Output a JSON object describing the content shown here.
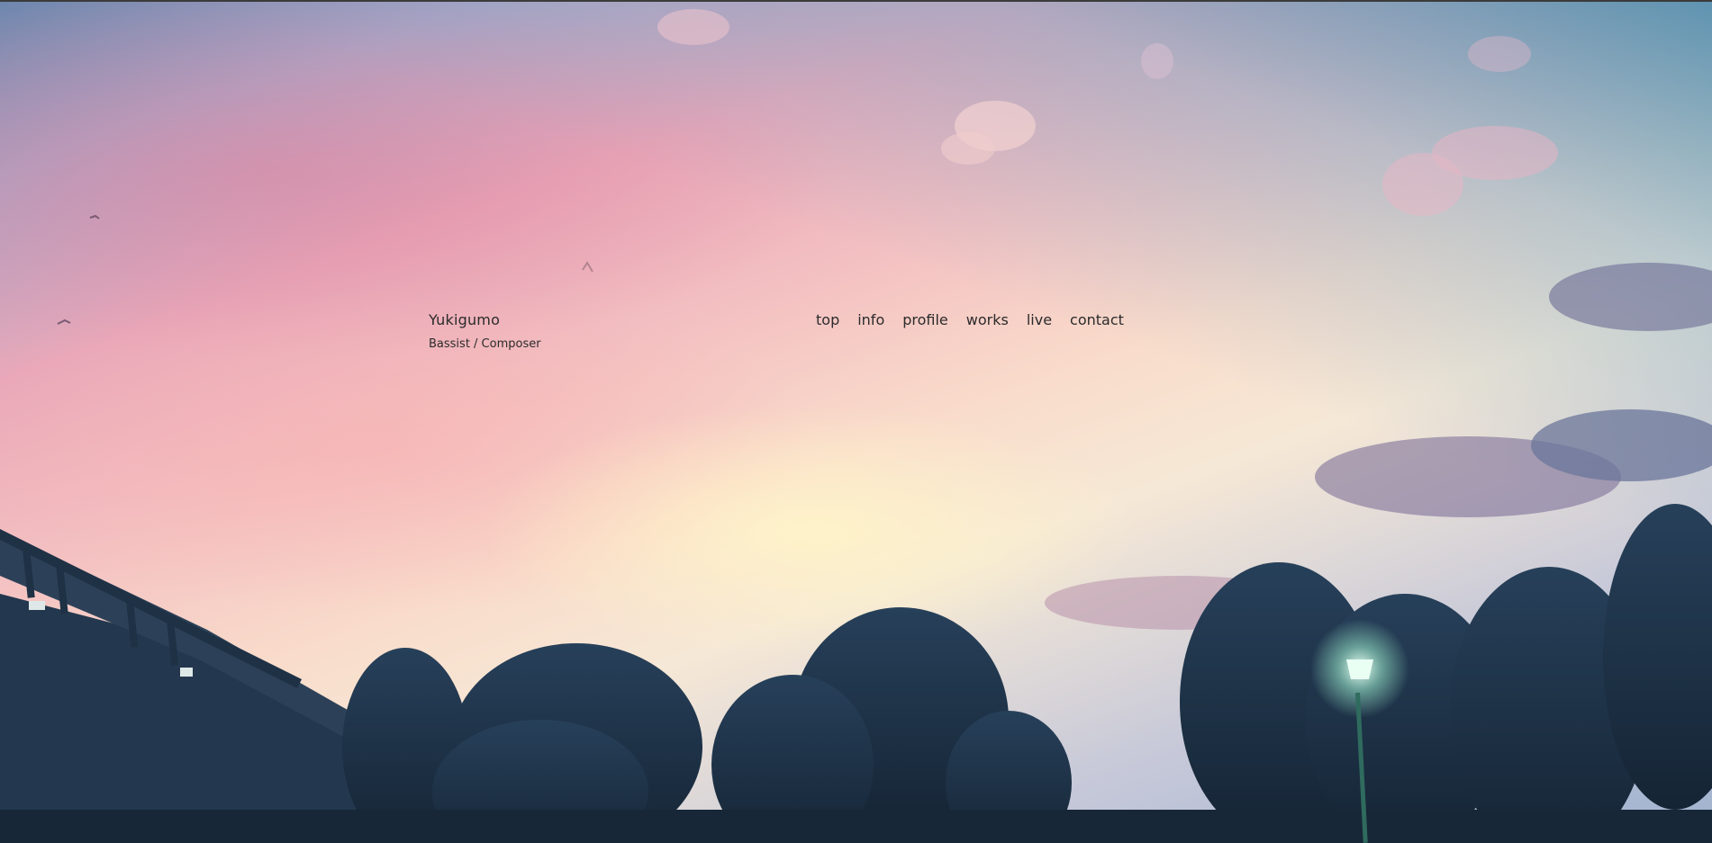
{
  "site": {
    "title": "Yukigumo",
    "subtitle": "Bassist / Composer"
  },
  "nav": {
    "items": [
      {
        "label": "top"
      },
      {
        "label": "info"
      },
      {
        "label": "profile"
      },
      {
        "label": "works"
      },
      {
        "label": "live"
      },
      {
        "label": "contact"
      }
    ]
  },
  "colors": {
    "text": "#2b2b2b",
    "sky_top_right": "#2c82aa",
    "sky_pink": "#e9a8b9",
    "sky_glow": "#fff6c8",
    "silhouette": "#1f3348",
    "lamp_light": "#eafff4"
  }
}
